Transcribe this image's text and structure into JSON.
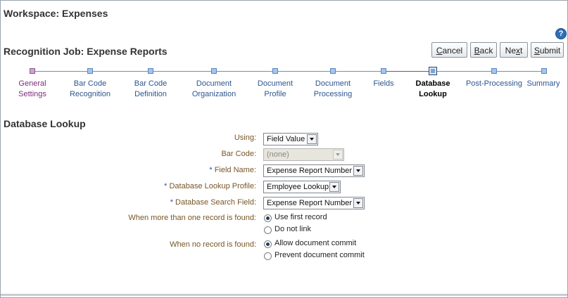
{
  "workspace_title": "Workspace: Expenses",
  "job_title": "Recognition Job: Expense Reports",
  "buttons": {
    "cancel": {
      "prefix": "",
      "ul": "C",
      "rest": "ancel"
    },
    "back": {
      "prefix": "",
      "ul": "B",
      "rest": "ack"
    },
    "next": {
      "prefix": "Ne",
      "ul": "x",
      "rest": "t"
    },
    "submit": {
      "prefix": "",
      "ul": "S",
      "rest": "ubmit"
    }
  },
  "train": [
    {
      "label": "General\nSettings",
      "state": "visited"
    },
    {
      "label": "Bar Code\nRecognition",
      "state": "unvisited"
    },
    {
      "label": "Bar Code\nDefinition",
      "state": "unvisited"
    },
    {
      "label": "Document\nOrganization",
      "state": "unvisited"
    },
    {
      "label": "Document\nProfile",
      "state": "unvisited"
    },
    {
      "label": "Document\nProcessing",
      "state": "unvisited"
    },
    {
      "label": "Fields",
      "state": "unvisited"
    },
    {
      "label": "Database\nLookup",
      "state": "current"
    },
    {
      "label": "Post-Processing",
      "state": "unvisited"
    },
    {
      "label": "Summary",
      "state": "unvisited"
    }
  ],
  "section_title": "Database Lookup",
  "form": {
    "using": {
      "label": "Using:",
      "value": "Field Value"
    },
    "bar_code": {
      "label": "Bar Code:",
      "value": "(none)"
    },
    "field_name": {
      "required": "*",
      "label": "Field Name:",
      "value": "Expense Report Number"
    },
    "lookup_profile": {
      "required": "*",
      "label": "Database Lookup Profile:",
      "value": "Employee Lookup"
    },
    "search_field": {
      "required": "*",
      "label": "Database Search Field:",
      "value": "Expense Report Number"
    },
    "multi_found": {
      "label": "When more than one record is found:",
      "options": [
        "Use first record",
        "Do not link"
      ],
      "selected": 0
    },
    "none_found": {
      "label": "When no record is found:",
      "options": [
        "Allow document commit",
        "Prevent document commit"
      ],
      "selected": 0
    }
  },
  "help_glyph": "?",
  "colors": {
    "visited": "#7d2b7f",
    "link": "#2c5590",
    "label": "#795526"
  }
}
